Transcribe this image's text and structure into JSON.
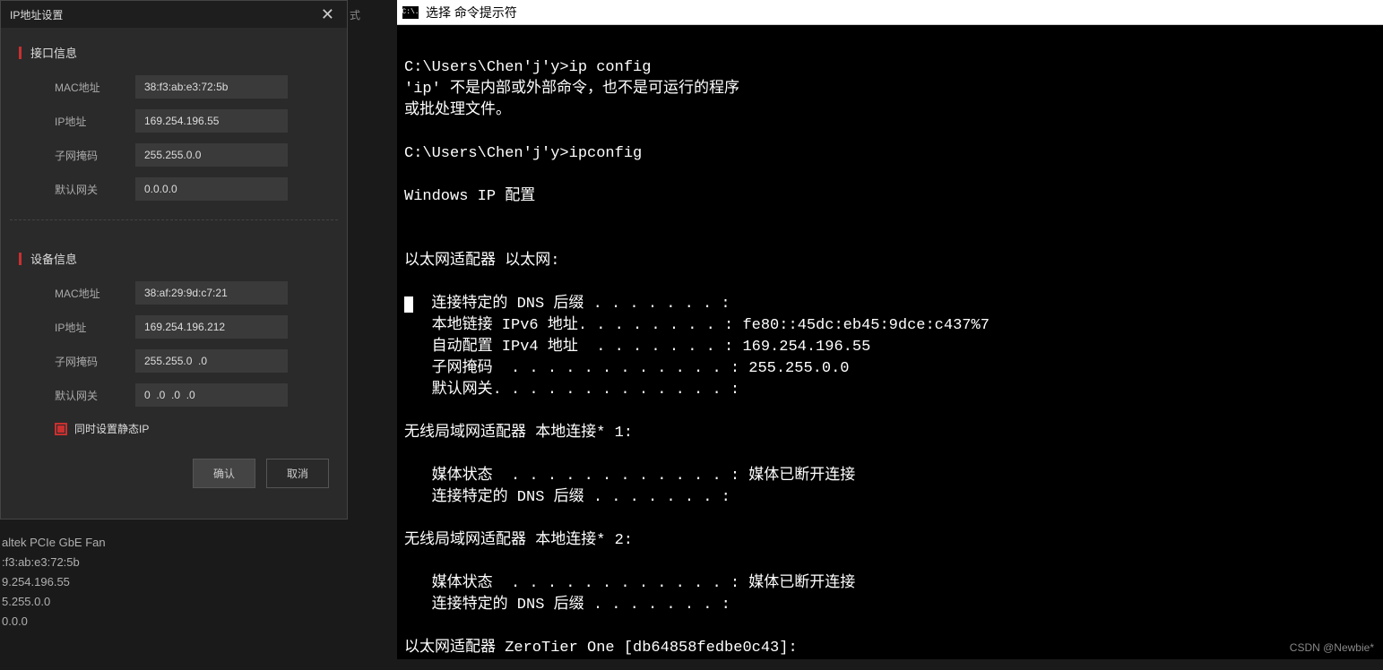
{
  "dialog": {
    "title": "IP地址设置",
    "section1": {
      "title": "接口信息",
      "rows": [
        {
          "label": "MAC地址",
          "value": "38:f3:ab:e3:72:5b"
        },
        {
          "label": "IP地址",
          "value": "169.254.196.55"
        },
        {
          "label": "子网掩码",
          "value": "255.255.0.0"
        },
        {
          "label": "默认网关",
          "value": "0.0.0.0"
        }
      ]
    },
    "section2": {
      "title": "设备信息",
      "rows": [
        {
          "label": "MAC地址",
          "value": "38:af:29:9d:c7:21"
        },
        {
          "label": "IP地址",
          "value": "169.254.196.212"
        },
        {
          "label": "子网掩码",
          "value": "255.255.0  .0"
        },
        {
          "label": "默认网关",
          "value": "0  .0  .0  .0"
        }
      ],
      "checkbox_label": "同时设置静态IP"
    },
    "buttons": {
      "ok": "确认",
      "cancel": "取消"
    }
  },
  "bg": {
    "tab_fragment": "式",
    "lines": [
      "altek PCIe GbE Fan",
      ":f3:ab:e3:72:5b",
      "9.254.196.55",
      "5.255.0.0",
      "0.0.0"
    ]
  },
  "cmd": {
    "icon_text": "C:\\.",
    "title": "选择 命令提示符",
    "lines": [
      "",
      "C:\\Users\\Chen'j'y>ip config",
      "'ip' 不是内部或外部命令，也不是可运行的程序",
      "或批处理文件。",
      "",
      "C:\\Users\\Chen'j'y>ipconfig",
      "",
      "Windows IP 配置",
      "",
      "",
      "以太网适配器 以太网:",
      "",
      "   连接特定的 DNS 后缀 . . . . . . . :",
      "   本地链接 IPv6 地址. . . . . . . . : fe80::45dc:eb45:9dce:c437%7",
      "   自动配置 IPv4 地址  . . . . . . . : 169.254.196.55",
      "   子网掩码  . . . . . . . . . . . . : 255.255.0.0",
      "   默认网关. . . . . . . . . . . . . :",
      "",
      "无线局域网适配器 本地连接* 1:",
      "",
      "   媒体状态  . . . . . . . . . . . . : 媒体已断开连接",
      "   连接特定的 DNS 后缀 . . . . . . . :",
      "",
      "无线局域网适配器 本地连接* 2:",
      "",
      "   媒体状态  . . . . . . . . . . . . : 媒体已断开连接",
      "   连接特定的 DNS 后缀 . . . . . . . :",
      "",
      "以太网适配器 ZeroTier One [db64858fedbe0c43]:"
    ]
  },
  "watermark": "CSDN @Newbie*"
}
